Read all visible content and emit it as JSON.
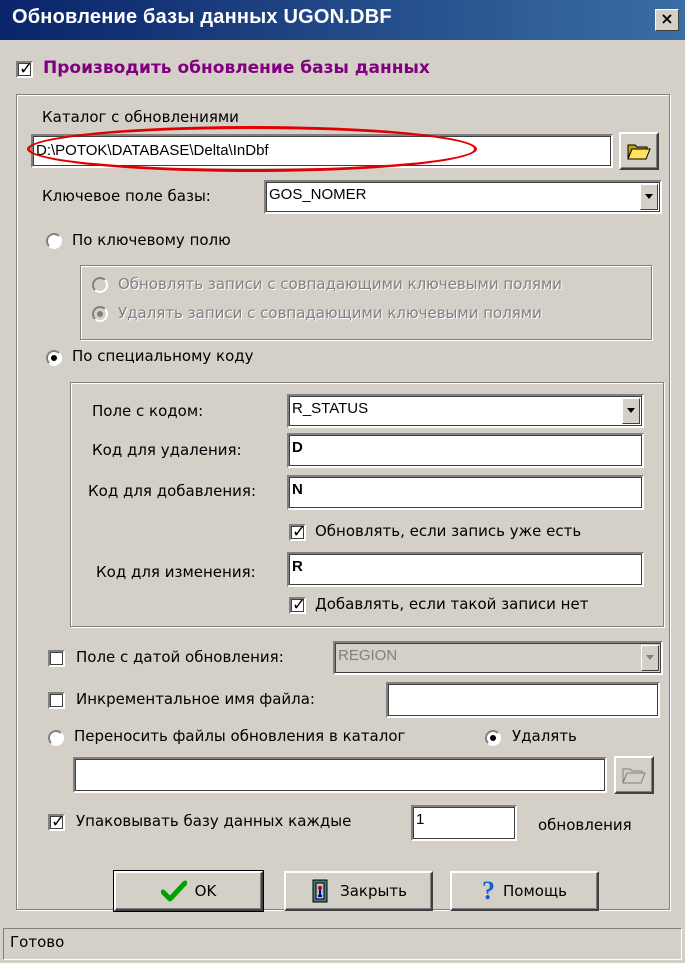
{
  "window": {
    "title": "Обновление базы данных UGON.DBF",
    "close_label": "×"
  },
  "update_enabled": {
    "label": "Производить обновление базы данных",
    "checked": true,
    "color": "#800080"
  },
  "catalog": {
    "label": "Каталог с обновлениями",
    "value": "D:\\POTOK\\DATABASE\\Delta\\InDbf",
    "highlight_color": "#e00000"
  },
  "key_field": {
    "label": "Ключевое поле базы:",
    "value": "GOS_NOMER"
  },
  "by_key": {
    "label": "По ключевому полю",
    "selected": false,
    "options": [
      {
        "label": "Обновлять записи с совпадающими ключевыми полями",
        "selected": false
      },
      {
        "label": "Удалять записи с совпадающими ключевыми полями",
        "selected": true
      }
    ]
  },
  "by_code": {
    "label": "По специальному коду",
    "selected": true,
    "code_field": {
      "label": "Поле с кодом:",
      "value": "R_STATUS"
    },
    "delete_code": {
      "label": "Код для удаления:",
      "value": "D"
    },
    "add_code": {
      "label": "Код для добавления:",
      "value": "N"
    },
    "update_if_exists": {
      "label": "Обновлять, если запись уже есть",
      "checked": true
    },
    "change_code": {
      "label": "Код для изменения:",
      "value": "R"
    },
    "add_if_missing": {
      "label": "Добавлять, если такой записи нет",
      "checked": true
    }
  },
  "date_field": {
    "label": "Поле с датой обновления:",
    "checked": false,
    "value": "REGION"
  },
  "incremental_name": {
    "label": "Инкрементальное имя файла:",
    "checked": false,
    "value": ""
  },
  "move_files": {
    "label": "Переносить файлы обновления в каталог",
    "selected": false,
    "value": ""
  },
  "delete_files": {
    "label": "Удалять",
    "selected": true
  },
  "pack": {
    "label": "Упаковывать базу данных каждые",
    "checked": true,
    "value": "1",
    "suffix": "обновления"
  },
  "buttons": {
    "ok": "OK",
    "close": "Закрыть",
    "help": "Помощь"
  },
  "status": "Готово"
}
